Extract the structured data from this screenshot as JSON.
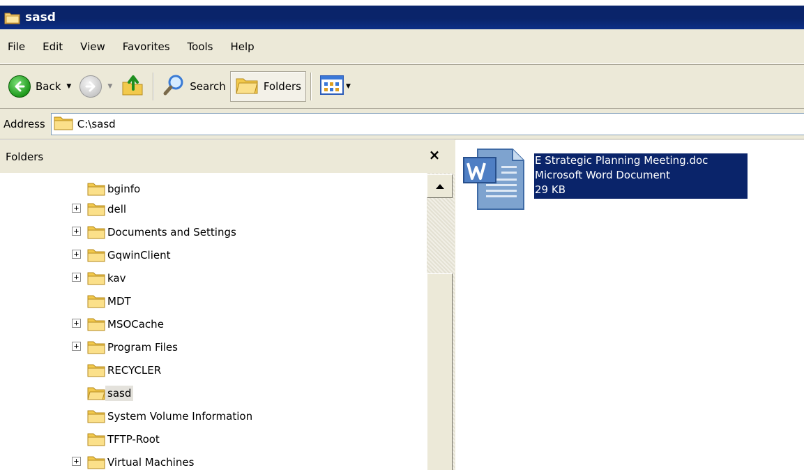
{
  "window": {
    "title": "sasd"
  },
  "menubar": {
    "items": [
      "File",
      "Edit",
      "View",
      "Favorites",
      "Tools",
      "Help"
    ]
  },
  "toolbar": {
    "back_label": "Back",
    "search_label": "Search",
    "folders_label": "Folders"
  },
  "address": {
    "label": "Address",
    "value": "C:\\sasd"
  },
  "folders_pane": {
    "title": "Folders",
    "close_glyph": "×",
    "items": [
      {
        "label": "bginfo",
        "expandable": false,
        "selected": false
      },
      {
        "label": "dell",
        "expandable": true,
        "selected": false
      },
      {
        "label": "Documents and Settings",
        "expandable": true,
        "selected": false
      },
      {
        "label": "GqwinClient",
        "expandable": true,
        "selected": false
      },
      {
        "label": "kav",
        "expandable": true,
        "selected": false
      },
      {
        "label": "MDT",
        "expandable": false,
        "selected": false
      },
      {
        "label": "MSOCache",
        "expandable": true,
        "selected": false
      },
      {
        "label": "Program Files",
        "expandable": true,
        "selected": false
      },
      {
        "label": "RECYCLER",
        "expandable": false,
        "selected": false
      },
      {
        "label": "sasd",
        "expandable": false,
        "selected": true
      },
      {
        "label": "System Volume Information",
        "expandable": false,
        "selected": false
      },
      {
        "label": "TFTP-Root",
        "expandable": false,
        "selected": false
      },
      {
        "label": "Virtual Machines",
        "expandable": true,
        "selected": false
      }
    ]
  },
  "file_pane": {
    "file": {
      "name": "E Strategic Planning Meeting.doc",
      "type": "Microsoft Word Document",
      "size": "29 KB",
      "icon": "word-document-icon"
    }
  }
}
